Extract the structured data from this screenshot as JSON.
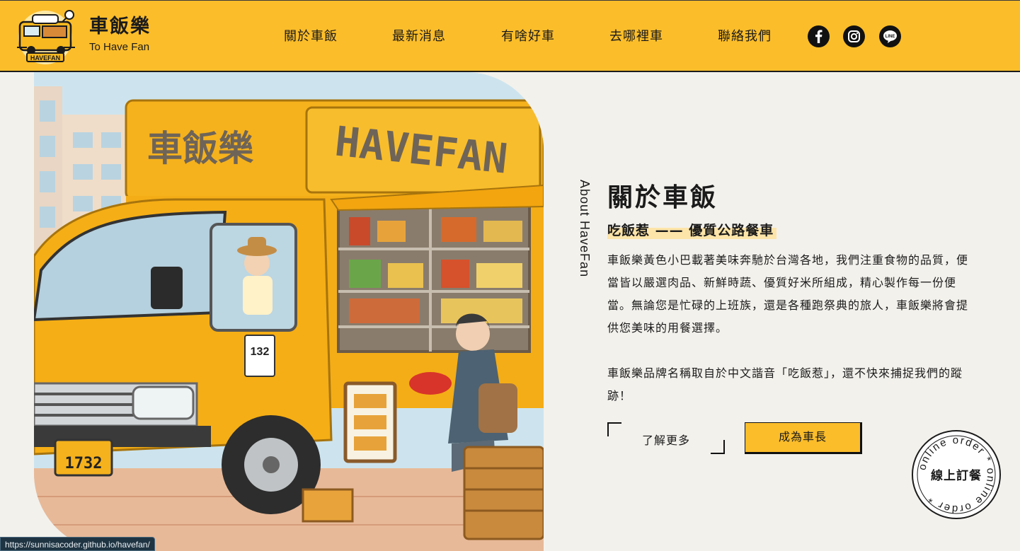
{
  "header": {
    "brand_name": "車飯樂",
    "brand_tagline": "To Have Fan",
    "logo_text": "HAVEFAN",
    "nav": [
      {
        "label": "關於車飯"
      },
      {
        "label": "最新消息"
      },
      {
        "label": "有啥好車"
      },
      {
        "label": "去哪裡車"
      },
      {
        "label": "聯絡我們"
      }
    ],
    "social": [
      {
        "icon": "facebook-icon"
      },
      {
        "icon": "instagram-icon"
      },
      {
        "icon": "line-icon",
        "text": "LINE"
      }
    ]
  },
  "hero": {
    "truck_sign_zh": "車飯樂",
    "truck_sign_en": "HAVEFAN",
    "truck_number": "132",
    "plate": "1732"
  },
  "about": {
    "vertical_label": "About HaveFan",
    "title": "關於車飯",
    "subtitle": "吃飯惹 —— 優質公路餐車",
    "paragraph_1": "車飯樂黃色小巴載著美味奔馳於台灣各地，我們注重食物的品質，便當皆以嚴選肉品、新鮮時蔬、優質好米所組成，精心製作每一份便當。無論您是忙碌的上班族，還是各種跑祭典的旅人，車飯樂將會提供您美味的用餐選擇。",
    "paragraph_2": "車飯樂品牌名稱取自於中文諧音「吃飯惹」，還不快來捕捉我們的蹤跡！",
    "btn_more": "了解更多",
    "btn_owner": "成為車長"
  },
  "order_stamp": {
    "center_label": "線上訂餐",
    "ring_text": "online order * online order *"
  },
  "status_bar": {
    "url": "https://sunnisacoder.github.io/havefan/"
  },
  "colors": {
    "accent": "#fbbd2a",
    "background": "#f3f1ec",
    "text": "#1b1b1b",
    "highlight": "#fde4a8"
  }
}
